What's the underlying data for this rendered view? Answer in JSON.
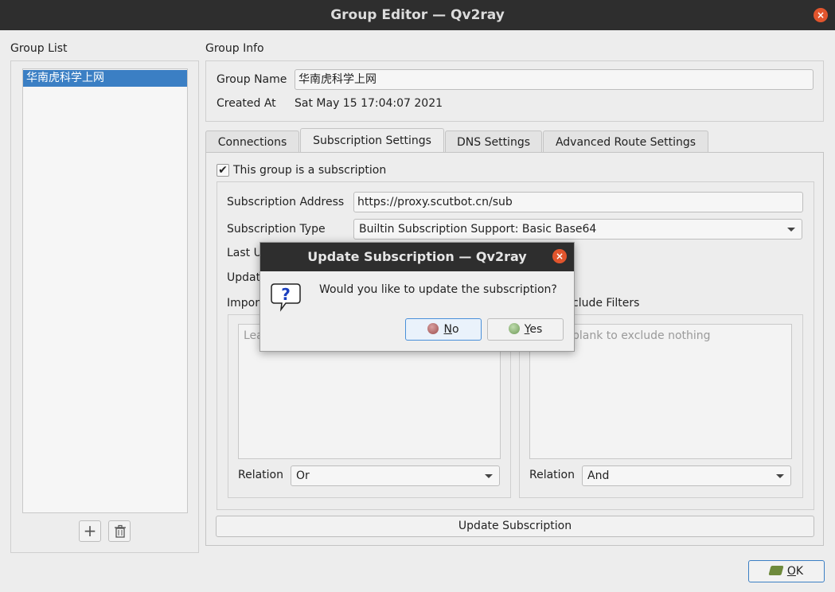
{
  "window": {
    "title": "Group Editor — Qv2ray",
    "close_label": "×"
  },
  "group_list": {
    "heading": "Group List",
    "items": [
      "华南虎科学上网"
    ],
    "add_label": "+",
    "delete_icon": "trash-icon"
  },
  "group_info": {
    "heading": "Group Info",
    "name_label": "Group Name",
    "name_value": "华南虎科学上网",
    "created_label": "Created At",
    "created_value": "Sat May 15 17:04:07 2021"
  },
  "tabs": [
    "Connections",
    "Subscription Settings",
    "DNS Settings",
    "Advanced Route Settings"
  ],
  "subscription": {
    "is_subscription_label": "This group is a subscription",
    "checked": true,
    "address_label": "Subscription Address",
    "address_value": "https://proxy.scutbot.cn/sub",
    "type_label": "Subscription Type",
    "type_value": "Builtin Subscription Support: Basic Base64",
    "last_update_label_partial": "Last U",
    "update_interval_label_partial": "Updat",
    "include_heading_partial": "Impor",
    "exclude_heading_partial": "clude Filters",
    "include_placeholder_partial": "Lea",
    "exclude_placeholder_partial": "blank to exclude nothing",
    "include_relation_label": "Relation",
    "include_relation_value": "Or",
    "exclude_relation_label": "Relation",
    "exclude_relation_value": "And",
    "update_button": "Update Subscription"
  },
  "ok_button": {
    "label_first": "O",
    "label_rest": "K"
  },
  "dialog": {
    "title": "Update Subscription — Qv2ray",
    "message": "Would you like to update the subscription?",
    "no_first": "N",
    "no_rest": "o",
    "yes_first": "Y",
    "yes_rest": "es",
    "close_label": "×"
  },
  "colors": {
    "accent": "#3b7fc4",
    "titlebar": "#2e2e2e",
    "close": "#e2552d"
  }
}
